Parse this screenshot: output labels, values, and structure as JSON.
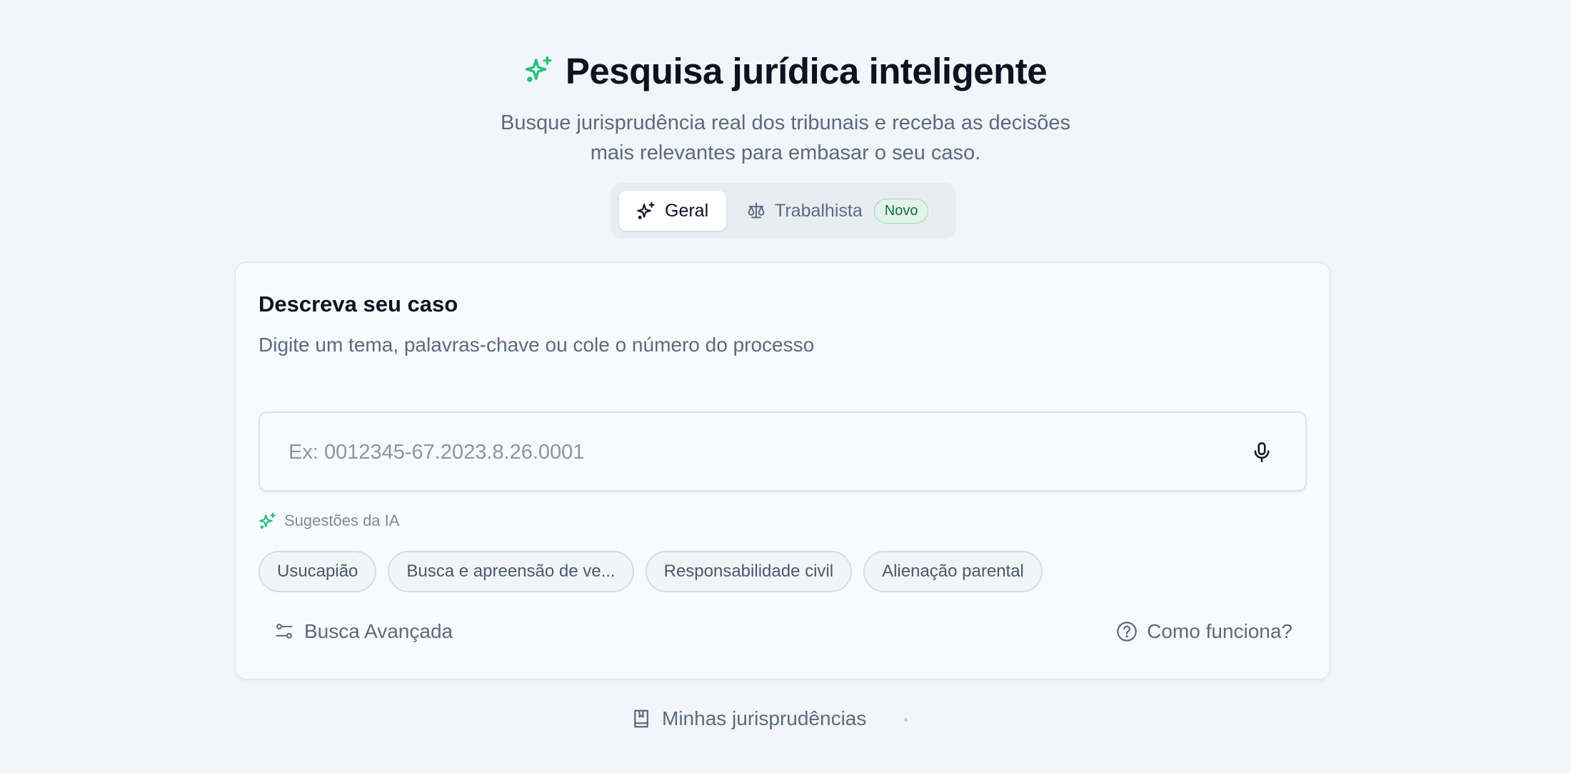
{
  "header": {
    "title": "Pesquisa jurídica inteligente",
    "subtitle_line1": "Busque jurisprudência real dos tribunais e receba as decisões",
    "subtitle_line2": "mais relevantes para embasar o seu caso.",
    "accent_color": "#22c17a"
  },
  "modes": {
    "general_label": "Geral",
    "labor_label": "Trabalhista",
    "labor_badge": "Novo",
    "selected": "Geral"
  },
  "card": {
    "title": "Descreva seu caso",
    "description": "Digite um tema, palavras-chave ou cole o número do processo",
    "search_placeholder": "Ex: 0012345-67.2023.8.26.0001",
    "search_value": "",
    "ai_suggestions_label": "Sugestões da IA",
    "suggestions": [
      "Usucapião",
      "Busca e apreensão de ve...",
      "Responsabilidade civil",
      "Alienação parental"
    ],
    "advanced_search_label": "Busca Avançada",
    "how_it_works_label": "Como funciona?"
  },
  "footer": {
    "my_jurisprudence_label": "Minhas jurisprudências"
  },
  "icons": {
    "title": "sparkles-icon",
    "general": "sparkles-icon",
    "labor": "scale-icon",
    "mic": "microphone-icon",
    "ai": "sparkles-icon",
    "advanced": "sliders-icon",
    "help": "question-circle-icon",
    "bookmark": "bookmark-book-icon"
  }
}
